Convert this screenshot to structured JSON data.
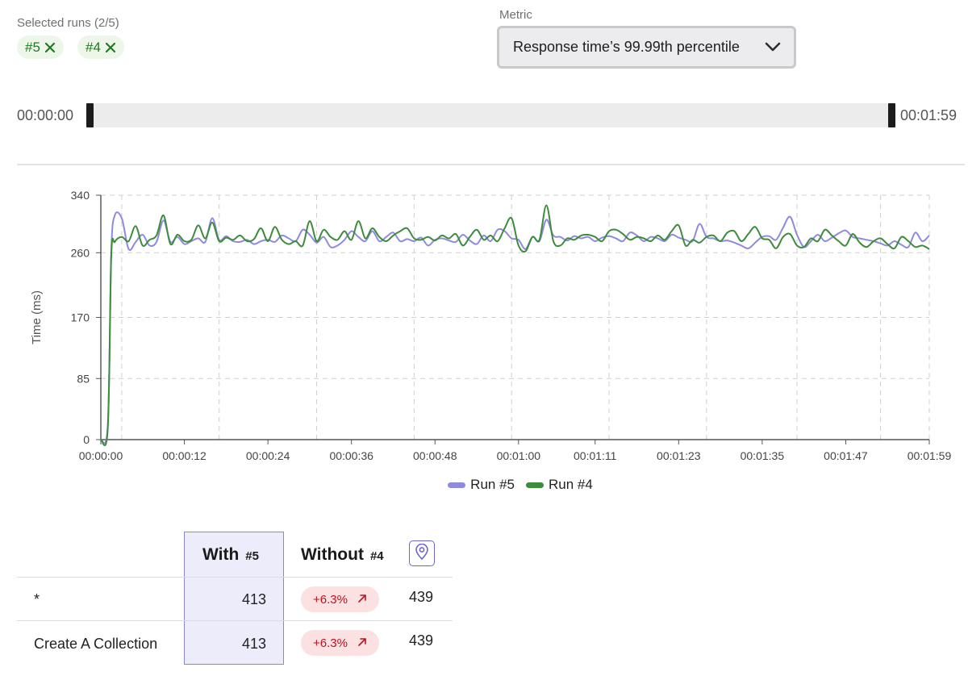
{
  "runs": {
    "label": "Selected runs (2/5)",
    "chips": [
      {
        "label": "#5",
        "icon": "close-icon"
      },
      {
        "label": "#4",
        "icon": "close-icon"
      }
    ]
  },
  "metric": {
    "label": "Metric",
    "selected": "Response time’s 99.99th percentile",
    "icon": "chevron-down-icon"
  },
  "range": {
    "start": "00:00:00",
    "end": "00:01:59"
  },
  "chart_data": {
    "type": "line",
    "ylabel": "Time (ms)",
    "xlabel": "",
    "y_ticks": [
      0,
      85,
      170,
      260,
      340
    ],
    "ylim": [
      0,
      340
    ],
    "x_ticks": [
      "00:00:00",
      "00:00:12",
      "00:00:24",
      "00:00:36",
      "00:00:48",
      "00:01:00",
      "00:01:11",
      "00:01:23",
      "00:01:35",
      "00:01:47",
      "00:01:59"
    ],
    "x_tick_seconds": [
      0,
      12,
      24,
      36,
      48,
      60,
      71,
      83,
      95,
      107,
      119
    ],
    "xlim": [
      0,
      119
    ],
    "grid": true,
    "legend": "bottom-center",
    "series": [
      {
        "name": "Run #5",
        "color": "#8e8ae0",
        "x": [
          0,
          1,
          1.5,
          2,
          3,
          4,
          5,
          6,
          7,
          8,
          9,
          10,
          11,
          12,
          13,
          14,
          15,
          16,
          17,
          18,
          19,
          20,
          21,
          22,
          23,
          24,
          25,
          26,
          27,
          28,
          29,
          30,
          31,
          32,
          33,
          34,
          35,
          36,
          37,
          38,
          39,
          40,
          41,
          42,
          43,
          44,
          45,
          46,
          47,
          48,
          49,
          50,
          51,
          52,
          53,
          54,
          55,
          56,
          57,
          58,
          59,
          60,
          61,
          62,
          63,
          64,
          65,
          66,
          67,
          68,
          69,
          70,
          71,
          72,
          73,
          74,
          75,
          76,
          77,
          78,
          79,
          80,
          81,
          82,
          83,
          84,
          85,
          86,
          87,
          88,
          89,
          90,
          91,
          92,
          93,
          94,
          95,
          96,
          97,
          98,
          99,
          100,
          101,
          102,
          103,
          104,
          105,
          106,
          107,
          108,
          109,
          110,
          111,
          112,
          113,
          114,
          115,
          116,
          117,
          118,
          119
        ],
        "y": [
          0,
          20,
          260,
          312,
          308,
          265,
          275,
          285,
          270,
          275,
          305,
          275,
          282,
          272,
          276,
          280,
          275,
          308,
          278,
          283,
          276,
          275,
          278,
          272,
          276,
          278,
          275,
          284,
          280,
          276,
          292,
          285,
          274,
          282,
          268,
          270,
          278,
          290,
          282,
          276,
          290,
          276,
          282,
          288,
          276,
          279,
          276,
          281,
          270,
          278,
          280,
          277,
          275,
          285,
          277,
          272,
          284,
          276,
          292,
          290,
          280,
          278,
          265,
          282,
          276,
          306,
          284,
          282,
          277,
          283,
          280,
          282,
          276,
          281,
          283,
          280,
          276,
          288,
          284,
          276,
          282,
          280,
          276,
          285,
          281,
          278,
          276,
          300,
          282,
          280,
          276,
          277,
          274,
          270,
          266,
          274,
          282,
          283,
          278,
          295,
          310,
          285,
          268,
          276,
          285,
          276,
          281,
          287,
          291,
          282,
          280,
          278,
          276,
          273,
          270,
          276,
          271,
          268,
          288,
          276,
          284
        ]
      },
      {
        "name": "Run #4",
        "color": "#3d8b3d",
        "x": [
          0,
          1,
          1.5,
          2,
          3,
          4,
          5,
          6,
          7,
          8,
          9,
          10,
          11,
          12,
          13,
          14,
          15,
          16,
          17,
          18,
          19,
          20,
          21,
          22,
          23,
          24,
          25,
          26,
          27,
          28,
          29,
          30,
          31,
          32,
          33,
          34,
          35,
          36,
          37,
          38,
          39,
          40,
          41,
          42,
          43,
          44,
          45,
          46,
          47,
          48,
          49,
          50,
          51,
          52,
          53,
          54,
          55,
          56,
          57,
          58,
          59,
          60,
          61,
          62,
          63,
          64,
          65,
          66,
          67,
          68,
          69,
          70,
          71,
          72,
          73,
          74,
          75,
          76,
          77,
          78,
          79,
          80,
          81,
          82,
          83,
          84,
          85,
          86,
          87,
          88,
          89,
          90,
          91,
          92,
          93,
          94,
          95,
          96,
          97,
          98,
          99,
          100,
          101,
          102,
          103,
          104,
          105,
          106,
          107,
          108,
          109,
          110,
          111,
          112,
          113,
          114,
          115,
          116,
          117,
          118,
          119
        ],
        "y": [
          0,
          15,
          255,
          275,
          282,
          276,
          297,
          270,
          278,
          284,
          312,
          272,
          285,
          276,
          278,
          298,
          280,
          302,
          276,
          281,
          278,
          284,
          276,
          279,
          294,
          276,
          296,
          278,
          272,
          276,
          270,
          304,
          276,
          292,
          282,
          278,
          290,
          278,
          304,
          280,
          294,
          282,
          276,
          284,
          290,
          294,
          280,
          278,
          282,
          277,
          284,
          280,
          286,
          270,
          282,
          292,
          278,
          284,
          276,
          294,
          308,
          270,
          262,
          282,
          278,
          326,
          276,
          270,
          280,
          278,
          284,
          285,
          282,
          276,
          290,
          292,
          286,
          278,
          282,
          280,
          276,
          284,
          278,
          290,
          298,
          270,
          278,
          274,
          282,
          284,
          276,
          288,
          290,
          276,
          286,
          296,
          280,
          278,
          266,
          282,
          286,
          270,
          268,
          280,
          276,
          292,
          284,
          276,
          270,
          286,
          274,
          268,
          276,
          280,
          272,
          266,
          282,
          276,
          268,
          270,
          265
        ]
      }
    ]
  },
  "table": {
    "headers": {
      "with": "With",
      "with_run": "#5",
      "without": "Without",
      "without_run": "#4",
      "pin_icon": "location-pin-icon"
    },
    "rows": [
      {
        "name": "*",
        "with": "413",
        "change": "+6.3%",
        "change_icon": "arrow-up-right-icon",
        "without": "439"
      },
      {
        "name": "Create A Collection",
        "with": "413",
        "change": "+6.3%",
        "change_icon": "arrow-up-right-icon",
        "without": "439"
      }
    ],
    "colors": {
      "increase_bg": "#fbe1e1",
      "increase_text": "#c0111b",
      "highlight": "#edecfb"
    }
  }
}
